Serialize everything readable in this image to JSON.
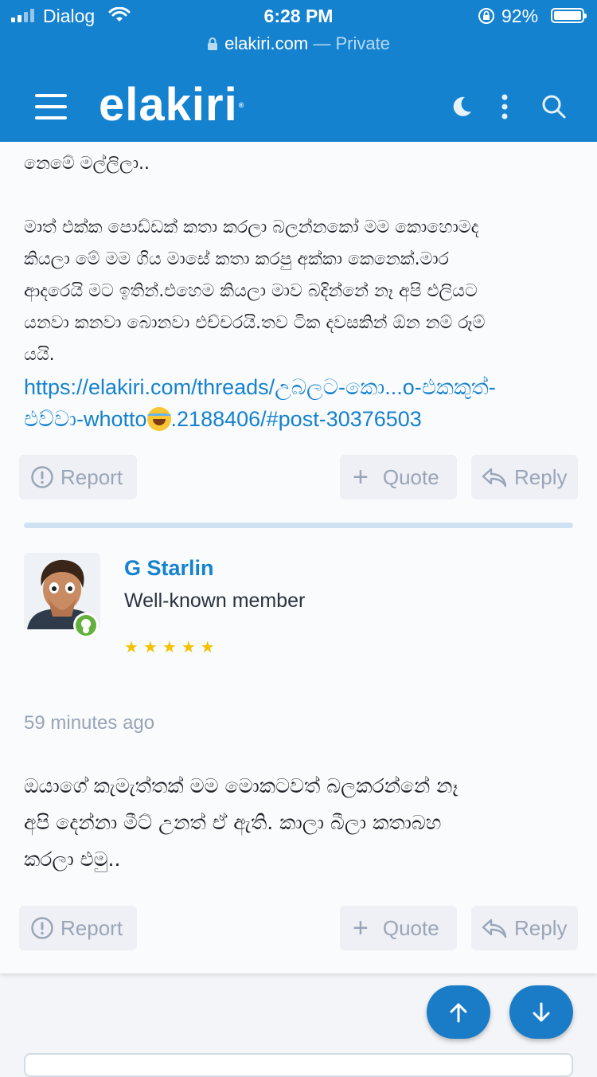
{
  "status_bar": {
    "carrier": "Dialog",
    "time": "6:28 PM",
    "battery": "92%"
  },
  "browser": {
    "host": "elakiri.com",
    "mode": "— Private"
  },
  "header": {
    "logo": "elakiri",
    "icons": [
      "menu-icon",
      "moon-icon",
      "more-vertical-icon",
      "search-icon"
    ],
    "background": "#1582d0"
  },
  "previous_post": {
    "lines_top": "නෙමේ මල්ලිලා..",
    "body_lines": [
      "මාත් එක්ක පොඩ්ඩක් කතා කරලා බලන්නකෝ මම කොහොමද",
      "කියලා මේ මම ගිය මාසේ කතා කරපු අක්කා කෙනෙක්.මාර",
      "ආදරෙයි මට ඉතින්.එහෙම කියලා මාව බදින්නේ නෑ අපි එලියට",
      "යනවා කනවා බොනවා එච්චරයි.තව ටික දවසකින් ඕන නම් රූම්",
      "යයි."
    ],
    "link_line1": "https://elakiri.com/threads/උබලට-කො...o-එකකුත්-",
    "link_line2_a": "එව්වා-whotto",
    "link_line2_b": ".2188406/#post-30376503",
    "actions": {
      "report": "Report",
      "quote": "Quote",
      "reply": "Reply"
    }
  },
  "post": {
    "author": "G Starlin",
    "user_title": "Well-known member",
    "rating_stars": 5,
    "time": "59 minutes ago",
    "body_lines": [
      "ඔයාගේ කැමැත්තක් මම මොකටවත් බලකරන්නේ නෑ",
      "අපි දෙන්නා මීට් උනත් ඒ ඇති. කාලා බීලා කතාබහ",
      "කරලා එමු.."
    ],
    "actions": {
      "report": "Report",
      "quote": "Quote",
      "reply": "Reply"
    }
  },
  "floating": {
    "icons": [
      "arrow-up-icon",
      "arrow-down-icon"
    ],
    "color": "#1a7cc6"
  }
}
